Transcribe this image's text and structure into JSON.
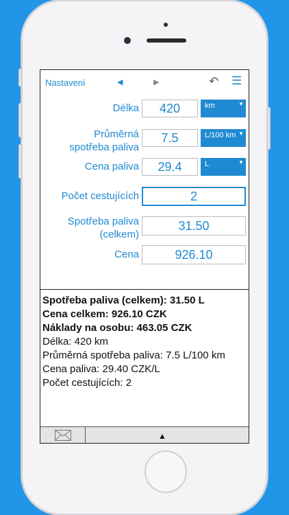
{
  "toolbar": {
    "settings_label": "Nastavení",
    "prev_icon": "◀",
    "next_icon": "▶",
    "undo_icon": "↶",
    "menu_icon": "☰"
  },
  "form": {
    "distance": {
      "label": "Délka",
      "value": "420",
      "unit": "km"
    },
    "consumption": {
      "label_line1": "Průměrná",
      "label_line2": "spotřeba paliva",
      "value": "7.5",
      "unit": "L/100 km"
    },
    "fuel_price": {
      "label": "Cena paliva",
      "value": "29.4",
      "unit": "L"
    },
    "passengers": {
      "label": "Počet cestujících",
      "value": "2"
    },
    "total_fuel": {
      "label_line1": "Spotřeba paliva",
      "label_line2": "(celkem)",
      "value": "31.50"
    },
    "price": {
      "label": "Cena",
      "value": "926.10"
    }
  },
  "summary": {
    "line1": "Spotřeba paliva (celkem): 31.50 L",
    "line2": "Cena celkem: 926.10 CZK",
    "line3": "Náklady na osobu: 463.05 CZK",
    "line4": "Délka: 420 km",
    "line5": "Průměrná spotřeba paliva: 7.5 L/100 km",
    "line6": "Cena paliva: 29.40 CZK/L",
    "line7": "Počet cestujících: 2"
  },
  "bottom": {
    "up_icon": "▲"
  },
  "colors": {
    "accent": "#1f8ad2",
    "background": "#2196e8"
  }
}
